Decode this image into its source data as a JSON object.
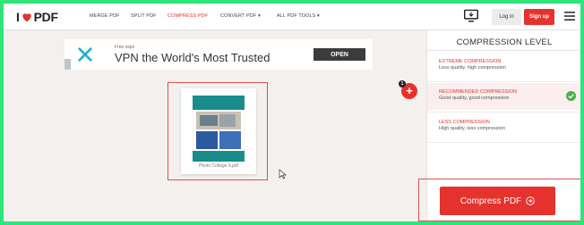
{
  "brand": {
    "logo_left": "I",
    "logo_right": "PDF",
    "accent": "#e5322d",
    "frame_color": "#2ee57a"
  },
  "nav": {
    "items": [
      {
        "label": "MERGE PDF"
      },
      {
        "label": "SPLIT PDF"
      },
      {
        "label": "COMPRESS PDF",
        "active": true
      },
      {
        "label": "CONVERT PDF ▾"
      },
      {
        "label": "ALL PDF TOOLS ▾"
      }
    ],
    "login": "Log in",
    "signup": "Sign up"
  },
  "ad": {
    "small": "Free vspn",
    "title": "VPN the World's Most Trusted",
    "open": "OPEN"
  },
  "file": {
    "name": "Photo Collage 6.pdf",
    "count_badge": "1",
    "add_label": "+"
  },
  "panel": {
    "title": "COMPRESSION LEVEL",
    "options": [
      {
        "name": "EXTREME COMPRESSION",
        "desc": "Less quality, high compression",
        "selected": false
      },
      {
        "name": "RECOMMENDED COMPRESSION",
        "desc": "Good quality, good compression",
        "selected": true
      },
      {
        "name": "LESS COMPRESSION",
        "desc": "High quality, less compression",
        "selected": false
      }
    ],
    "compress_button": "Compress PDF"
  },
  "icons": [
    "heart-icon",
    "monitor-icon",
    "menu-icon",
    "ad-close-x-icon",
    "check-icon",
    "arrow-right-circle-icon",
    "cursor-icon",
    "add-icon"
  ]
}
